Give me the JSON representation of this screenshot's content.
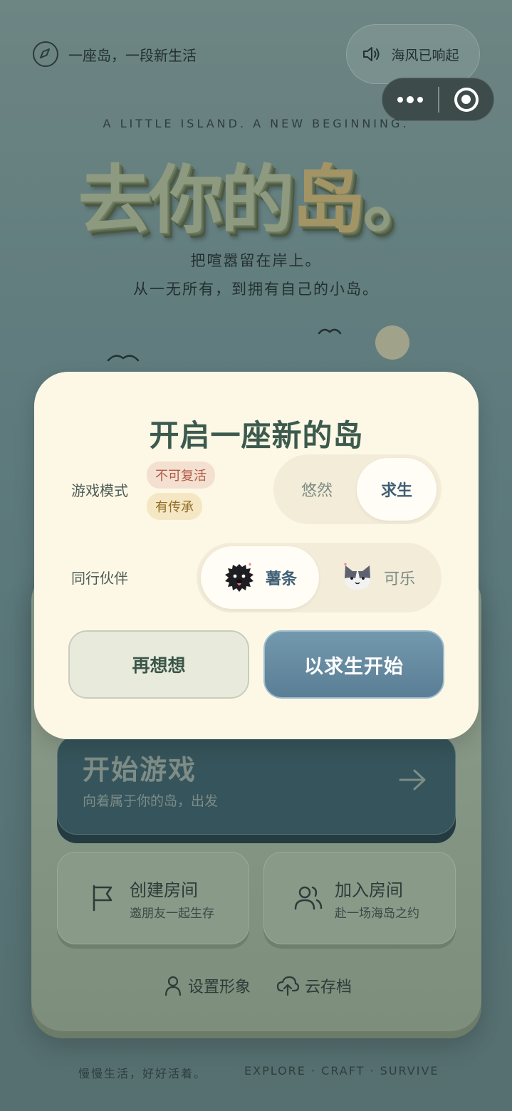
{
  "header": {
    "tagline": "一座岛，一段新生活",
    "sound_label": "海风已响起",
    "subtitle_en": "A LITTLE ISLAND. A NEW BEGINNING.",
    "title_main": "去你的",
    "title_accent": "岛",
    "title_end": "。",
    "line1": "把喧嚣留在岸上。",
    "line2": "从一无所有，到拥有自己的小岛。"
  },
  "menu": {
    "start_title": "开始游戏",
    "start_sub": "向着属于你的岛，出发",
    "create_title": "创建房间",
    "create_sub": "邀朋友一起生存",
    "join_title": "加入房间",
    "join_sub": "赴一场海岛之约",
    "avatar_label": "设置形象",
    "cloud_label": "云存档"
  },
  "footer": {
    "left": "慢慢生活，好好活着。",
    "right": "EXPLORE · CRAFT · SURVIVE"
  },
  "modal": {
    "title": "开启一座新的岛",
    "mode_label": "游戏模式",
    "tag_no_revive": "不可复活",
    "tag_legacy": "有传承",
    "mode_relaxed": "悠然",
    "mode_survival": "求生",
    "mode_selected": "求生",
    "companion_label": "同行伙伴",
    "pet_1": "薯条",
    "pet_2": "可乐",
    "pet_selected": "薯条",
    "cancel_label": "再想想",
    "confirm_label": "以求生开始"
  },
  "colors": {
    "modal_bg": "#fdf8e6",
    "accent_blue": "#5a7e95",
    "title_green": "#3c5a4e"
  }
}
